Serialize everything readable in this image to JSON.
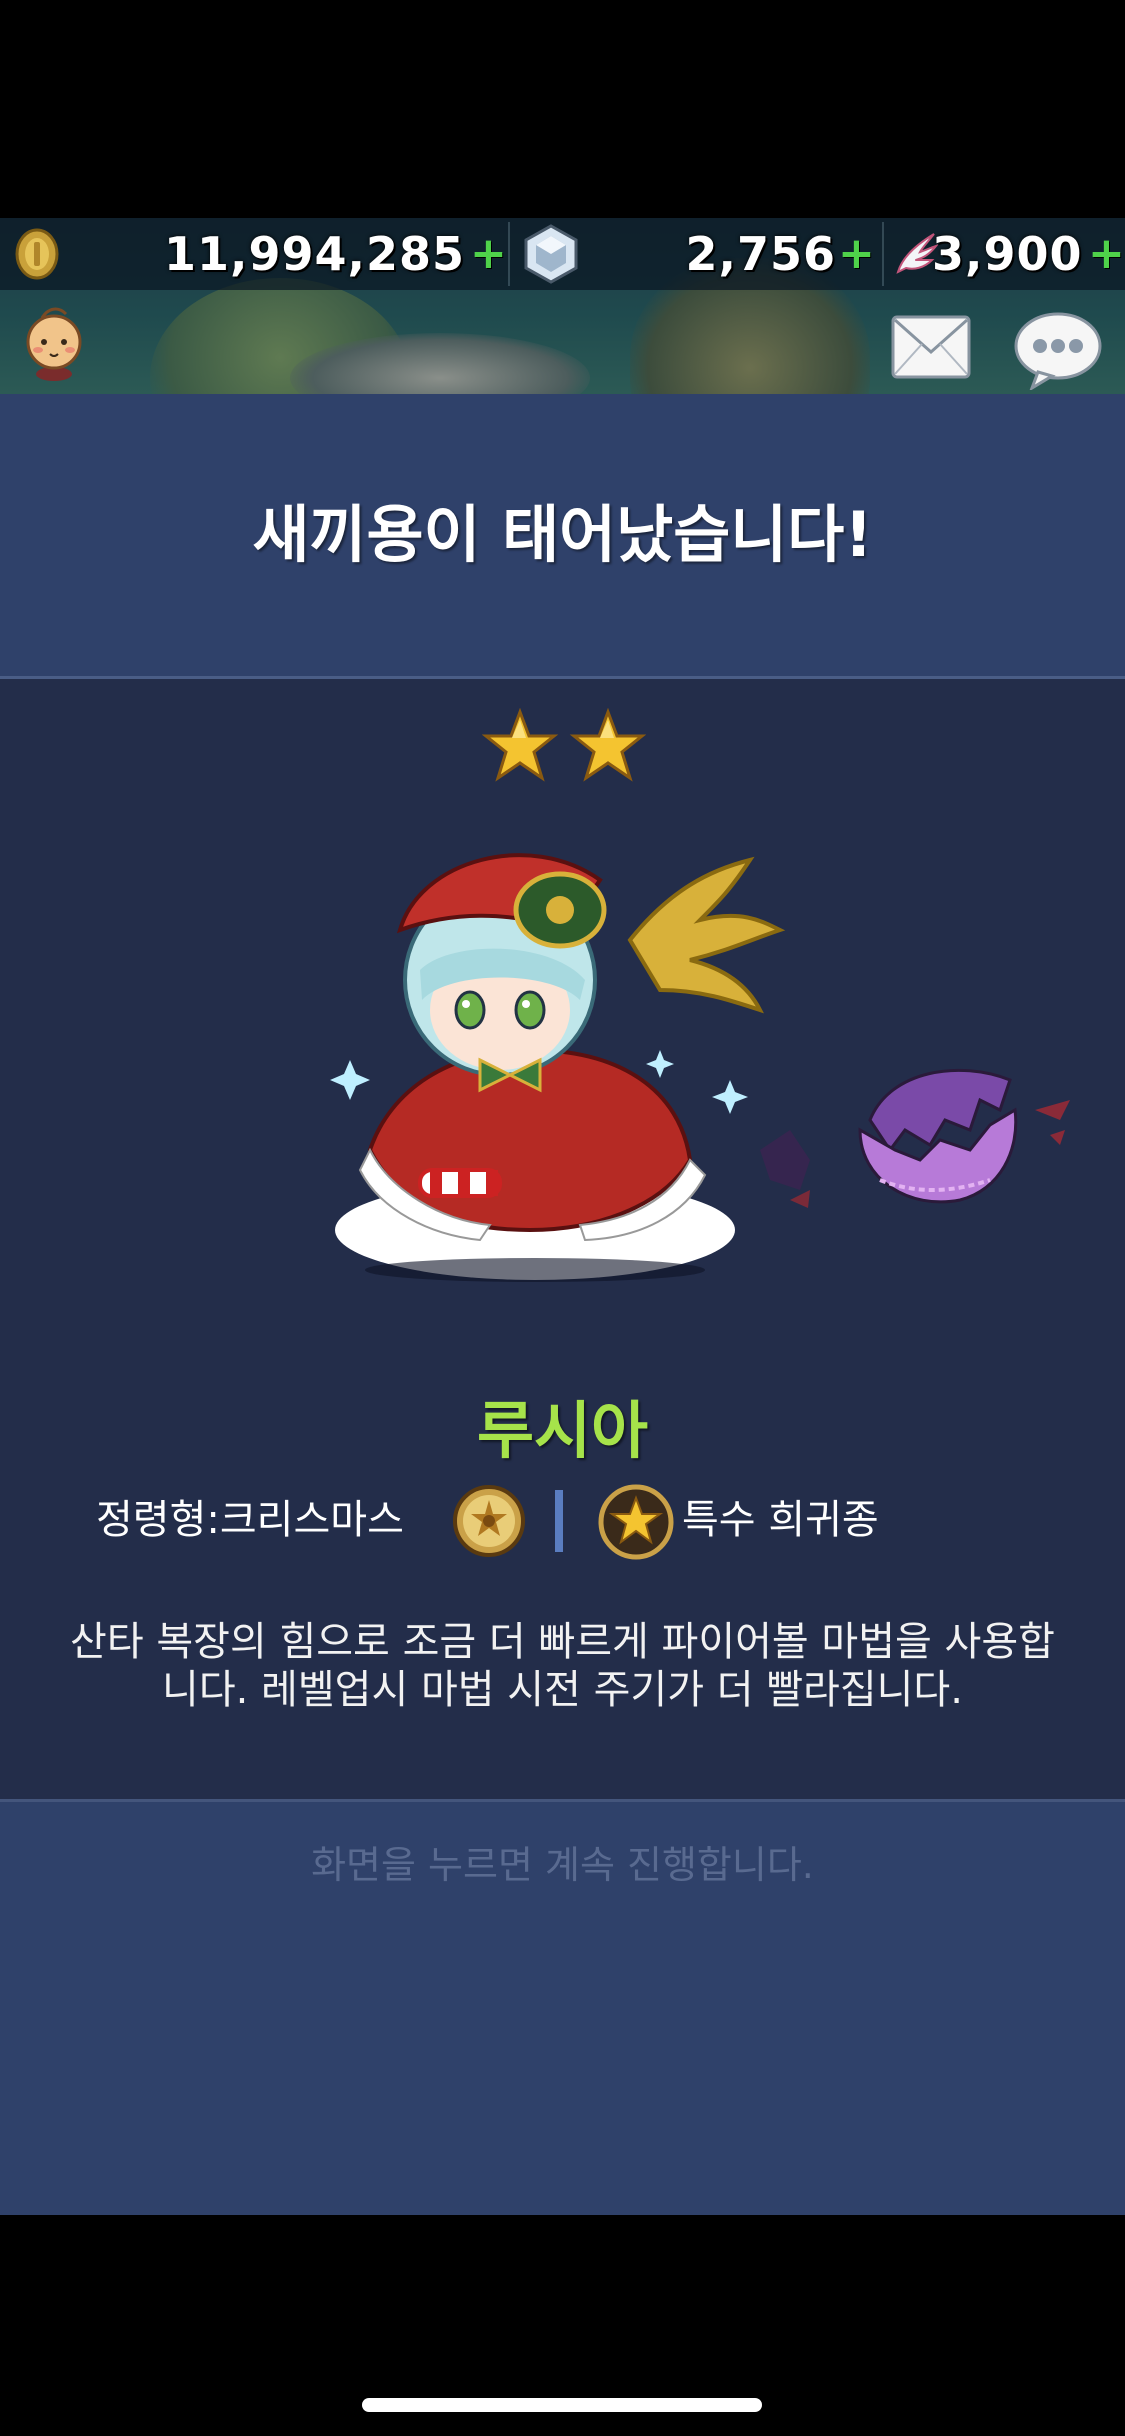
{
  "resources": {
    "gold": "11,994,285",
    "crystal": "2,756",
    "wing": "3,900",
    "plus_symbol": "+"
  },
  "header_icons": [
    "coin-icon",
    "crystal-icon",
    "wing-icon",
    "mascot-icon",
    "mail-icon",
    "chat-icon"
  ],
  "title": "새끼용이 태어났습니다!",
  "dragon": {
    "stars": 2,
    "name": "루시아",
    "type_label": "정령형:크리스마스",
    "rarity_label": "특수 희귀종",
    "description": "산타 복장의 힘으로 조금 더 빠르게 파이어볼 마법을 사용합니다. 레벨업시 마법 시전 주기가 더 빨라집니다."
  },
  "footer": {
    "hint": "화면을 누르면 계속 진행합니다."
  },
  "colors": {
    "panel": "#2f416a",
    "panel_dark": "#232d4a",
    "name_green": "#a6e34a",
    "plus_green": "#4fd24a",
    "star_gold": "#f4c430"
  }
}
